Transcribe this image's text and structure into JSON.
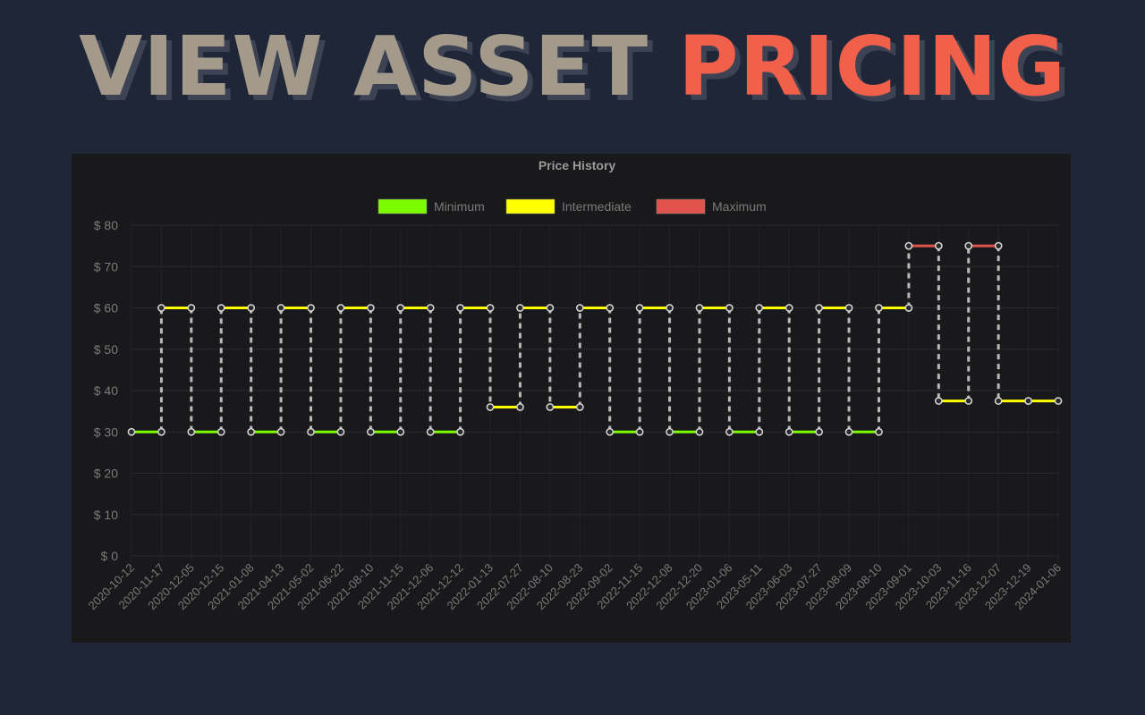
{
  "header": {
    "title_part1": "VIEW ASSET",
    "title_part2": "PRICING",
    "colors": {
      "part1": "#a39a8b",
      "part2": "#f1604b",
      "background": "#1f2637"
    }
  },
  "chart_data": {
    "type": "line",
    "title": "Price History",
    "xlabel": "",
    "ylabel": "",
    "ylim": [
      0,
      80
    ],
    "ytick_labels": [
      "$ 0",
      "$ 10",
      "$ 20",
      "$ 30",
      "$ 40",
      "$ 50",
      "$ 60",
      "$ 70",
      "$ 80"
    ],
    "grid": true,
    "legend_position": "top-center",
    "categories": [
      "2020-10-12",
      "2020-11-17",
      "2020-12-05",
      "2020-12-15",
      "2021-01-08",
      "2021-04-13",
      "2021-05-02",
      "2021-06-22",
      "2021-08-10",
      "2021-11-15",
      "2021-12-06",
      "2021-12-12",
      "2022-01-13",
      "2022-07-27",
      "2022-08-10",
      "2022-08-23",
      "2022-09-02",
      "2022-11-15",
      "2022-12-08",
      "2022-12-20",
      "2023-01-06",
      "2023-05-11",
      "2023-06-03",
      "2023-07-27",
      "2023-08-09",
      "2023-08-10",
      "2023-09-01",
      "2023-10-03",
      "2023-11-16",
      "2023-12-07",
      "2023-12-19",
      "2024-01-06"
    ],
    "series": [
      {
        "name": "Minimum",
        "color": "#7cfc00"
      },
      {
        "name": "Intermediate",
        "color": "#ffff00"
      },
      {
        "name": "Maximum",
        "color": "#e0534b"
      }
    ],
    "segments": [
      {
        "from": 0,
        "to": 1,
        "value": 30,
        "series": "Minimum"
      },
      {
        "from": 1,
        "to": 2,
        "value": 60,
        "series": "Intermediate"
      },
      {
        "from": 2,
        "to": 3,
        "value": 30,
        "series": "Minimum"
      },
      {
        "from": 3,
        "to": 4,
        "value": 60,
        "series": "Intermediate"
      },
      {
        "from": 4,
        "to": 5,
        "value": 30,
        "series": "Minimum"
      },
      {
        "from": 5,
        "to": 6,
        "value": 60,
        "series": "Intermediate"
      },
      {
        "from": 6,
        "to": 7,
        "value": 30,
        "series": "Minimum"
      },
      {
        "from": 7,
        "to": 8,
        "value": 60,
        "series": "Intermediate"
      },
      {
        "from": 8,
        "to": 9,
        "value": 30,
        "series": "Minimum"
      },
      {
        "from": 9,
        "to": 10,
        "value": 60,
        "series": "Intermediate"
      },
      {
        "from": 10,
        "to": 11,
        "value": 30,
        "series": "Minimum"
      },
      {
        "from": 11,
        "to": 12,
        "value": 60,
        "series": "Intermediate"
      },
      {
        "from": 12,
        "to": 13,
        "value": 36,
        "series": "Intermediate"
      },
      {
        "from": 13,
        "to": 14,
        "value": 60,
        "series": "Intermediate"
      },
      {
        "from": 14,
        "to": 15,
        "value": 36,
        "series": "Intermediate"
      },
      {
        "from": 15,
        "to": 16,
        "value": 60,
        "series": "Intermediate"
      },
      {
        "from": 16,
        "to": 17,
        "value": 30,
        "series": "Minimum"
      },
      {
        "from": 17,
        "to": 18,
        "value": 60,
        "series": "Intermediate"
      },
      {
        "from": 18,
        "to": 19,
        "value": 30,
        "series": "Minimum"
      },
      {
        "from": 19,
        "to": 20,
        "value": 60,
        "series": "Intermediate"
      },
      {
        "from": 20,
        "to": 21,
        "value": 30,
        "series": "Minimum"
      },
      {
        "from": 21,
        "to": 22,
        "value": 60,
        "series": "Intermediate"
      },
      {
        "from": 22,
        "to": 23,
        "value": 30,
        "series": "Minimum"
      },
      {
        "from": 23,
        "to": 24,
        "value": 60,
        "series": "Intermediate"
      },
      {
        "from": 24,
        "to": 25,
        "value": 30,
        "series": "Minimum"
      },
      {
        "from": 25,
        "to": 26,
        "value": 60,
        "series": "Intermediate"
      },
      {
        "from": 26,
        "to": 27,
        "value": 75,
        "series": "Maximum"
      },
      {
        "from": 27,
        "to": 28,
        "value": 37.5,
        "series": "Intermediate"
      },
      {
        "from": 28,
        "to": 29,
        "value": 75,
        "series": "Maximum"
      },
      {
        "from": 29,
        "to": 30,
        "value": 37.5,
        "series": "Intermediate"
      },
      {
        "from": 30,
        "to": 31,
        "value": 37.5,
        "series": "Intermediate"
      }
    ]
  }
}
